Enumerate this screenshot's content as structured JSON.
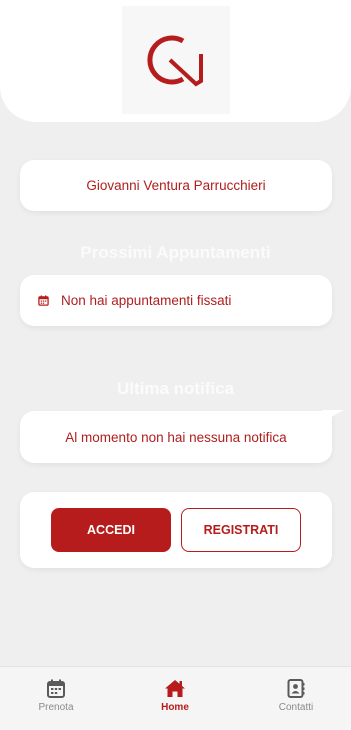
{
  "header": {
    "logo_icon": "gv-monogram-logo"
  },
  "salon": {
    "name": "Giovanni Ventura Parrucchieri"
  },
  "appointments": {
    "title": "Prossimi Appuntamenti",
    "empty_text": "Non hai appuntamenti fissati",
    "icon": "calendar-icon"
  },
  "notifications": {
    "title": "Ultima notifica",
    "empty_text": "Al momento non hai nessuna notifica"
  },
  "auth": {
    "login_label": "ACCEDI",
    "register_label": "REGISTRATI"
  },
  "nav": {
    "items": [
      {
        "label": "Prenota",
        "icon": "calendar-icon",
        "active": false
      },
      {
        "label": "Home",
        "icon": "home-icon",
        "active": true
      },
      {
        "label": "Contatti",
        "icon": "contact-book-icon",
        "active": false
      }
    ]
  },
  "colors": {
    "accent": "#b71c1c",
    "background": "#efefef",
    "nav_inactive": "#8a8a8a"
  }
}
